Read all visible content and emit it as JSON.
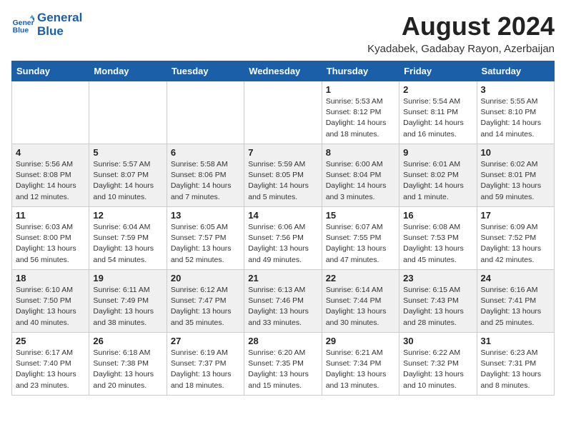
{
  "logo": {
    "line1": "General",
    "line2": "Blue"
  },
  "title": {
    "month_year": "August 2024",
    "location": "Kyadabek, Gadabay Rayon, Azerbaijan"
  },
  "weekdays": [
    "Sunday",
    "Monday",
    "Tuesday",
    "Wednesday",
    "Thursday",
    "Friday",
    "Saturday"
  ],
  "weeks": [
    [
      {
        "day": "",
        "info": ""
      },
      {
        "day": "",
        "info": ""
      },
      {
        "day": "",
        "info": ""
      },
      {
        "day": "",
        "info": ""
      },
      {
        "day": "1",
        "info": "Sunrise: 5:53 AM\nSunset: 8:12 PM\nDaylight: 14 hours\nand 18 minutes."
      },
      {
        "day": "2",
        "info": "Sunrise: 5:54 AM\nSunset: 8:11 PM\nDaylight: 14 hours\nand 16 minutes."
      },
      {
        "day": "3",
        "info": "Sunrise: 5:55 AM\nSunset: 8:10 PM\nDaylight: 14 hours\nand 14 minutes."
      }
    ],
    [
      {
        "day": "4",
        "info": "Sunrise: 5:56 AM\nSunset: 8:08 PM\nDaylight: 14 hours\nand 12 minutes."
      },
      {
        "day": "5",
        "info": "Sunrise: 5:57 AM\nSunset: 8:07 PM\nDaylight: 14 hours\nand 10 minutes."
      },
      {
        "day": "6",
        "info": "Sunrise: 5:58 AM\nSunset: 8:06 PM\nDaylight: 14 hours\nand 7 minutes."
      },
      {
        "day": "7",
        "info": "Sunrise: 5:59 AM\nSunset: 8:05 PM\nDaylight: 14 hours\nand 5 minutes."
      },
      {
        "day": "8",
        "info": "Sunrise: 6:00 AM\nSunset: 8:04 PM\nDaylight: 14 hours\nand 3 minutes."
      },
      {
        "day": "9",
        "info": "Sunrise: 6:01 AM\nSunset: 8:02 PM\nDaylight: 14 hours\nand 1 minute."
      },
      {
        "day": "10",
        "info": "Sunrise: 6:02 AM\nSunset: 8:01 PM\nDaylight: 13 hours\nand 59 minutes."
      }
    ],
    [
      {
        "day": "11",
        "info": "Sunrise: 6:03 AM\nSunset: 8:00 PM\nDaylight: 13 hours\nand 56 minutes."
      },
      {
        "day": "12",
        "info": "Sunrise: 6:04 AM\nSunset: 7:59 PM\nDaylight: 13 hours\nand 54 minutes."
      },
      {
        "day": "13",
        "info": "Sunrise: 6:05 AM\nSunset: 7:57 PM\nDaylight: 13 hours\nand 52 minutes."
      },
      {
        "day": "14",
        "info": "Sunrise: 6:06 AM\nSunset: 7:56 PM\nDaylight: 13 hours\nand 49 minutes."
      },
      {
        "day": "15",
        "info": "Sunrise: 6:07 AM\nSunset: 7:55 PM\nDaylight: 13 hours\nand 47 minutes."
      },
      {
        "day": "16",
        "info": "Sunrise: 6:08 AM\nSunset: 7:53 PM\nDaylight: 13 hours\nand 45 minutes."
      },
      {
        "day": "17",
        "info": "Sunrise: 6:09 AM\nSunset: 7:52 PM\nDaylight: 13 hours\nand 42 minutes."
      }
    ],
    [
      {
        "day": "18",
        "info": "Sunrise: 6:10 AM\nSunset: 7:50 PM\nDaylight: 13 hours\nand 40 minutes."
      },
      {
        "day": "19",
        "info": "Sunrise: 6:11 AM\nSunset: 7:49 PM\nDaylight: 13 hours\nand 38 minutes."
      },
      {
        "day": "20",
        "info": "Sunrise: 6:12 AM\nSunset: 7:47 PM\nDaylight: 13 hours\nand 35 minutes."
      },
      {
        "day": "21",
        "info": "Sunrise: 6:13 AM\nSunset: 7:46 PM\nDaylight: 13 hours\nand 33 minutes."
      },
      {
        "day": "22",
        "info": "Sunrise: 6:14 AM\nSunset: 7:44 PM\nDaylight: 13 hours\nand 30 minutes."
      },
      {
        "day": "23",
        "info": "Sunrise: 6:15 AM\nSunset: 7:43 PM\nDaylight: 13 hours\nand 28 minutes."
      },
      {
        "day": "24",
        "info": "Sunrise: 6:16 AM\nSunset: 7:41 PM\nDaylight: 13 hours\nand 25 minutes."
      }
    ],
    [
      {
        "day": "25",
        "info": "Sunrise: 6:17 AM\nSunset: 7:40 PM\nDaylight: 13 hours\nand 23 minutes."
      },
      {
        "day": "26",
        "info": "Sunrise: 6:18 AM\nSunset: 7:38 PM\nDaylight: 13 hours\nand 20 minutes."
      },
      {
        "day": "27",
        "info": "Sunrise: 6:19 AM\nSunset: 7:37 PM\nDaylight: 13 hours\nand 18 minutes."
      },
      {
        "day": "28",
        "info": "Sunrise: 6:20 AM\nSunset: 7:35 PM\nDaylight: 13 hours\nand 15 minutes."
      },
      {
        "day": "29",
        "info": "Sunrise: 6:21 AM\nSunset: 7:34 PM\nDaylight: 13 hours\nand 13 minutes."
      },
      {
        "day": "30",
        "info": "Sunrise: 6:22 AM\nSunset: 7:32 PM\nDaylight: 13 hours\nand 10 minutes."
      },
      {
        "day": "31",
        "info": "Sunrise: 6:23 AM\nSunset: 7:31 PM\nDaylight: 13 hours\nand 8 minutes."
      }
    ]
  ]
}
